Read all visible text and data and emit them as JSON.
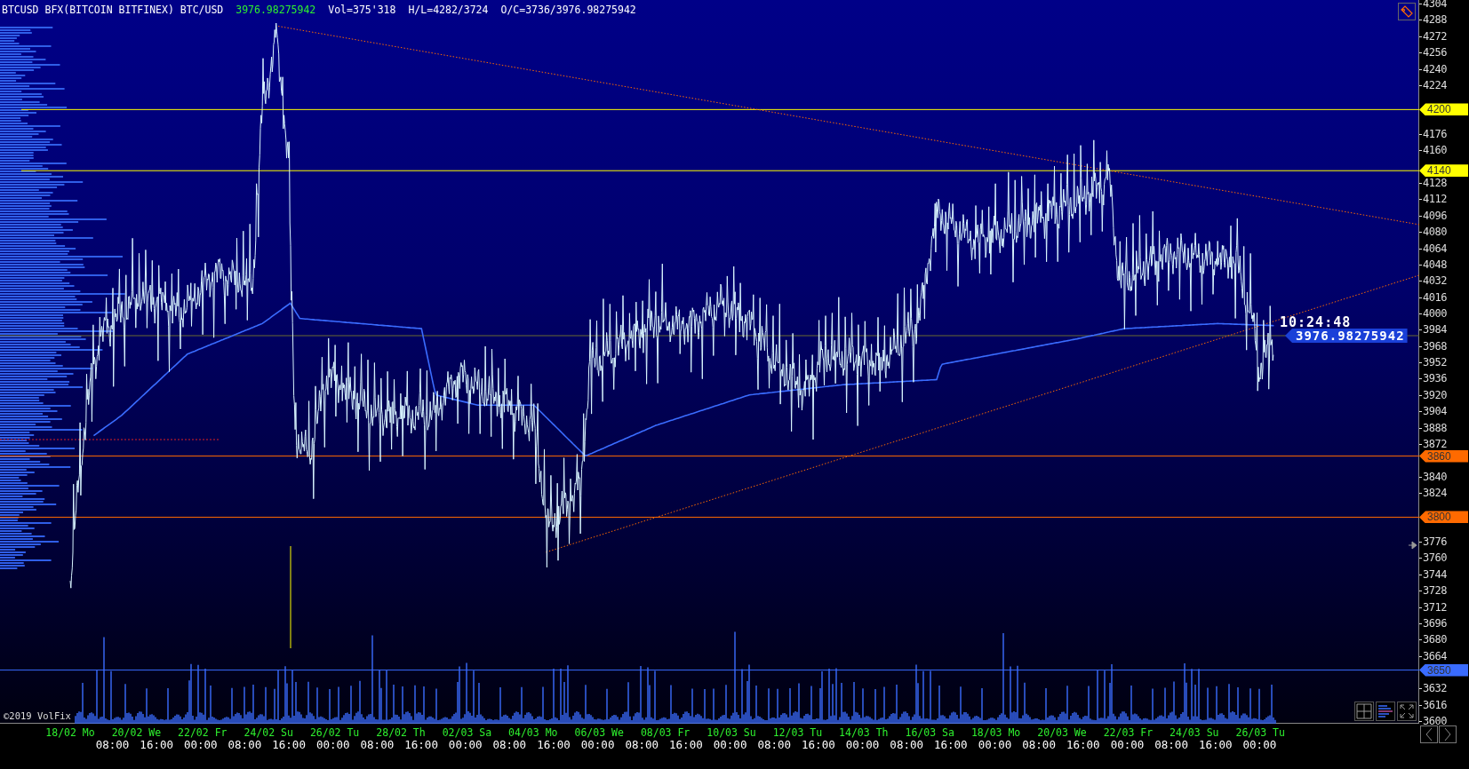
{
  "header": {
    "symbol": "BTCUSD BFX(BITCOIN BITFINEX) BTC/USD",
    "last_price": "3976.98275942",
    "volume": "Vol=375'318",
    "high_low": "H/L=4282/3724",
    "open_close": "O/C=3736/3976.98275942"
  },
  "price_axis": {
    "ticks": [
      "4304",
      "4288",
      "4272",
      "4256",
      "4240",
      "4224",
      "4176",
      "4160",
      "4128",
      "4112",
      "4096",
      "4080",
      "4064",
      "4048",
      "4032",
      "4016",
      "4000",
      "3984",
      "3968",
      "3952",
      "3936",
      "3920",
      "3904",
      "3888",
      "3872",
      "3840",
      "3824",
      "3776",
      "3760",
      "3744",
      "3728",
      "3712",
      "3696",
      "3680",
      "3664",
      "3632",
      "3616",
      "3600"
    ],
    "level_markers": [
      {
        "label": "4200",
        "color": "#ffff00"
      },
      {
        "label": "4140",
        "color": "#ffff00"
      },
      {
        "label": "3860",
        "color": "#ff6a00"
      },
      {
        "label": "3800",
        "color": "#ff6a00"
      },
      {
        "label": "3650",
        "color": "#3a6cff"
      }
    ],
    "countdown": "10:24:48",
    "current_price": "3976.98275942"
  },
  "time_axis": {
    "dates": [
      "18/02 Mo",
      "20/02 We",
      "22/02 Fr",
      "24/02 Su",
      "26/02 Tu",
      "28/02 Th",
      "02/03 Sa",
      "04/03 Mo",
      "06/03 We",
      "08/03 Fr",
      "10/03 Su",
      "12/03 Tu",
      "14/03 Th",
      "16/03 Sa",
      "18/03 Mo",
      "20/03 We",
      "22/03 Fr",
      "24/03 Su",
      "26/03 Tu"
    ],
    "times": [
      "08:00",
      "16:00",
      "00:00",
      "08:00",
      "16:00",
      "00:00",
      "08:00",
      "16:00",
      "00:00",
      "08:00",
      "16:00",
      "00:00",
      "08:00",
      "16:00",
      "00:00",
      "08:00",
      "16:00",
      "00:00",
      "08:00",
      "16:00",
      "00:00",
      "08:00",
      "16:00",
      "00:00",
      "08:00",
      "16:00",
      "00:00"
    ]
  },
  "copyright": "©2019 VolFix"
}
